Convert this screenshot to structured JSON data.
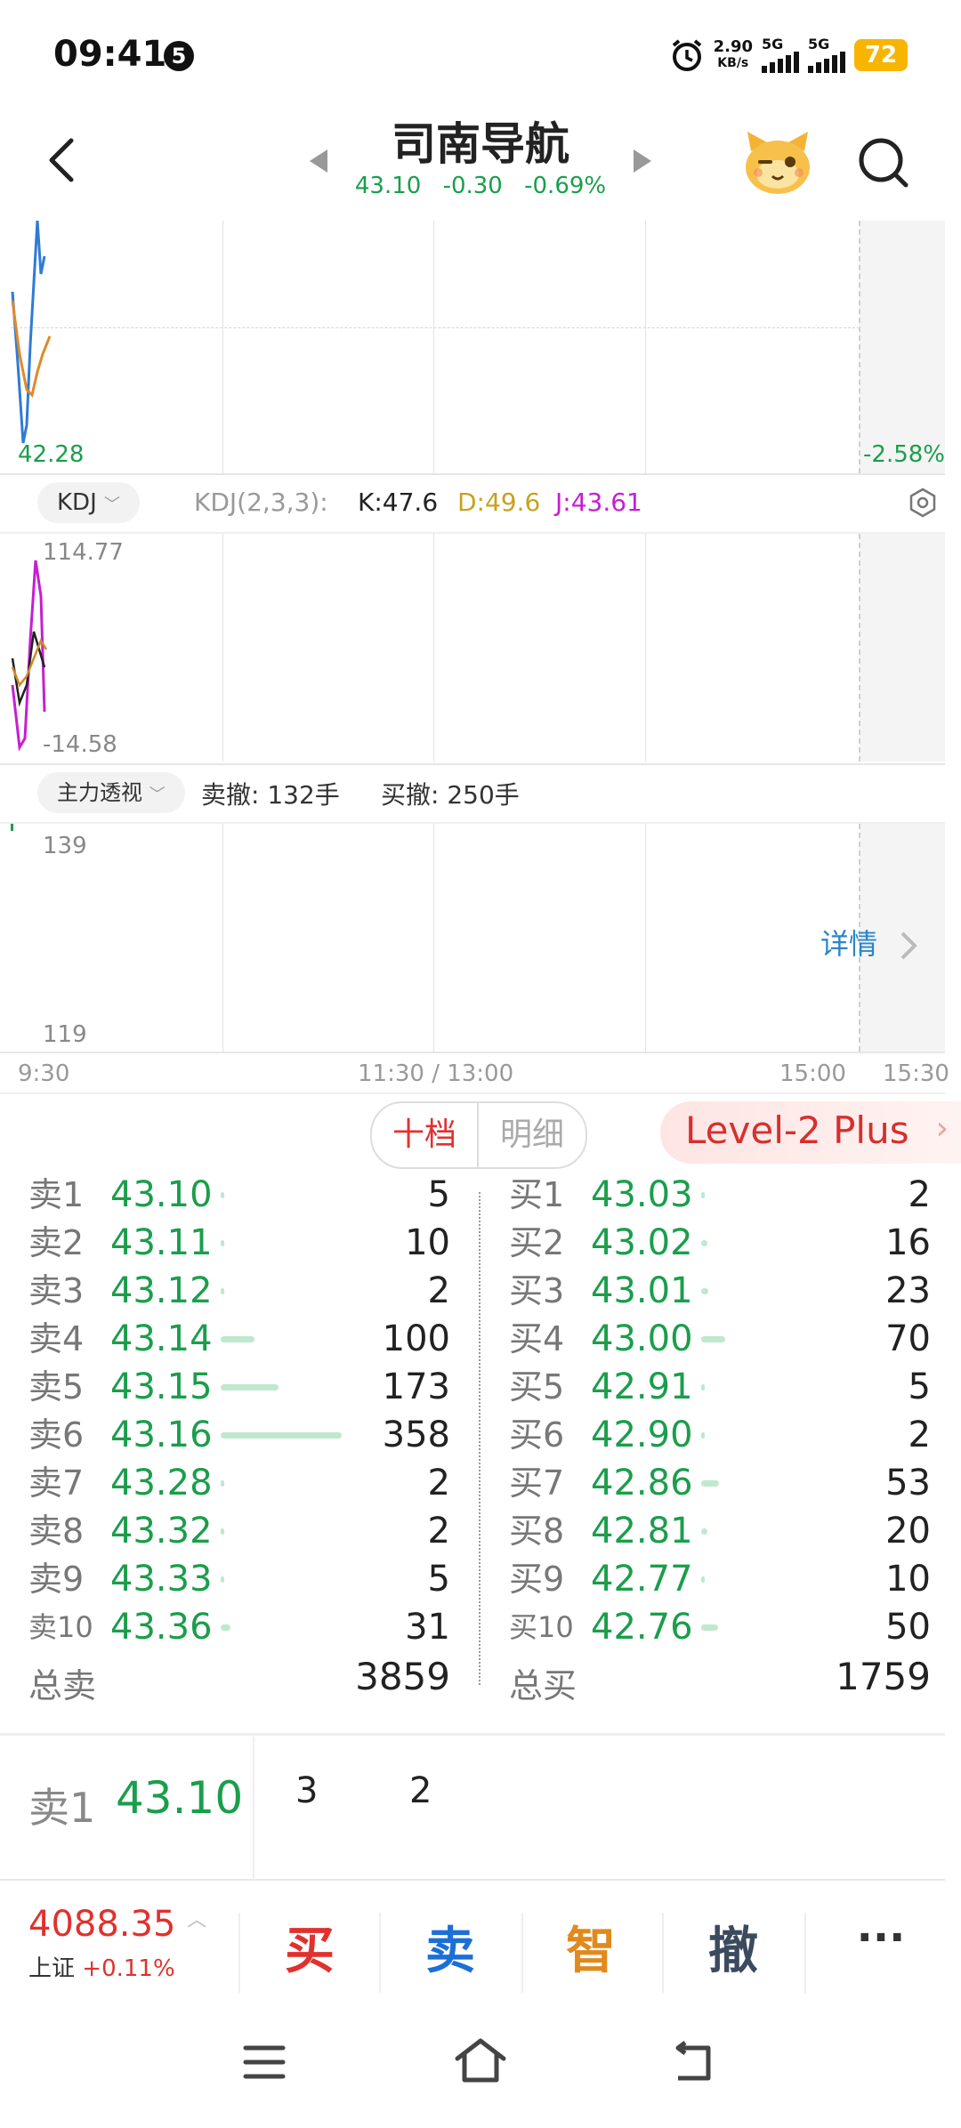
{
  "status": {
    "time": "09:41",
    "notif": "5",
    "speed_top": "2.90",
    "speed_bottom": "KB/s",
    "net1": "5G",
    "net2": "5G",
    "battery": "72"
  },
  "header": {
    "title": "司南导航",
    "price": "43.10",
    "change": "-0.30",
    "pct": "-0.69%"
  },
  "chart": {
    "low_label": "42.28",
    "pct_label": "-2.58%"
  },
  "kdj": {
    "tab": "KDJ",
    "params": "KDJ(2,3,3):",
    "k": "K:47.6",
    "d": "D:49.6",
    "j": "J:43.61",
    "max": "114.77",
    "min": "-14.58"
  },
  "flow": {
    "tab": "主力透视",
    "sell_cancel": "卖撤: 132手",
    "buy_cancel": "买撤: 250手",
    "top": "139",
    "bottom": "119",
    "detail": "详情"
  },
  "time_axis": {
    "t1": "9:30",
    "t2": "11:30 / 13:00",
    "t3": "15:00",
    "t4": "15:30"
  },
  "tabs": {
    "ten": "十档",
    "detail": "明细",
    "level2": "Level-2 Plus"
  },
  "asks": [
    {
      "label": "卖1",
      "price": "43.10",
      "qty": "5",
      "bar": 0.0
    },
    {
      "label": "卖2",
      "price": "43.11",
      "qty": "10",
      "bar": 0.0
    },
    {
      "label": "卖3",
      "price": "43.12",
      "qty": "2",
      "bar": 0.0
    },
    {
      "label": "卖4",
      "price": "43.14",
      "qty": "100",
      "bar": 0.28
    },
    {
      "label": "卖5",
      "price": "43.15",
      "qty": "173",
      "bar": 0.48
    },
    {
      "label": "卖6",
      "price": "43.16",
      "qty": "358",
      "bar": 1.0
    },
    {
      "label": "卖7",
      "price": "43.28",
      "qty": "2",
      "bar": 0.0
    },
    {
      "label": "卖8",
      "price": "43.32",
      "qty": "2",
      "bar": 0.0
    },
    {
      "label": "卖9",
      "price": "43.33",
      "qty": "5",
      "bar": 0.0
    },
    {
      "label": "卖10",
      "price": "43.36",
      "qty": "31",
      "bar": 0.08
    }
  ],
  "bids": [
    {
      "label": "买1",
      "price": "43.03",
      "qty": "2",
      "bar": 0.0
    },
    {
      "label": "买2",
      "price": "43.02",
      "qty": "16",
      "bar": 0.05
    },
    {
      "label": "买3",
      "price": "43.01",
      "qty": "23",
      "bar": 0.06
    },
    {
      "label": "买4",
      "price": "43.00",
      "qty": "70",
      "bar": 0.2
    },
    {
      "label": "买5",
      "price": "42.91",
      "qty": "5",
      "bar": 0.0
    },
    {
      "label": "买6",
      "price": "42.90",
      "qty": "2",
      "bar": 0.0
    },
    {
      "label": "买7",
      "price": "42.86",
      "qty": "53",
      "bar": 0.15
    },
    {
      "label": "买8",
      "price": "42.81",
      "qty": "20",
      "bar": 0.05
    },
    {
      "label": "买9",
      "price": "42.77",
      "qty": "10",
      "bar": 0.03
    },
    {
      "label": "买10",
      "price": "42.76",
      "qty": "50",
      "bar": 0.14
    }
  ],
  "totals": {
    "sell_label": "总卖",
    "sell_value": "3859",
    "buy_label": "总买",
    "buy_value": "1759"
  },
  "selected": {
    "label": "卖1",
    "price": "43.10",
    "v1": "3",
    "v2": "2"
  },
  "index": {
    "value": "4088.35",
    "name": "上证",
    "pct": "+0.11%"
  },
  "actions": {
    "buy": "买",
    "sell": "卖",
    "smart": "智",
    "cancel": "撤",
    "more": "···"
  },
  "colors": {
    "green": "#1a9e4b",
    "red": "#e0312f",
    "blue": "#1c6fd6",
    "orange": "#e08a1e"
  }
}
